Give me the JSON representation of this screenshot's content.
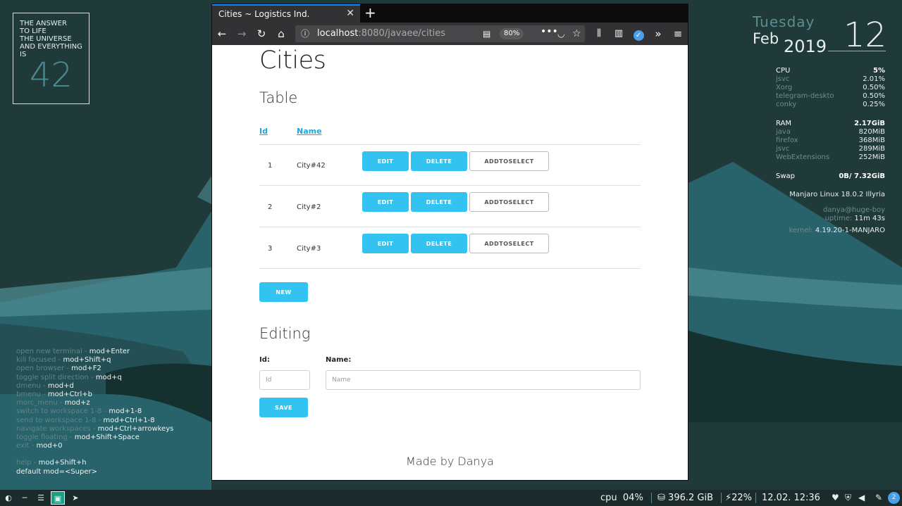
{
  "desktop": {
    "answer_box": {
      "lines": [
        "THE ANSWER",
        "TO LIFE",
        "THE UNIVERSE",
        "AND EVERYTHING",
        "IS"
      ],
      "number": "42"
    },
    "date": {
      "weekday": "Tuesday",
      "month": "Feb",
      "year": "2019",
      "day": "12"
    },
    "conky": {
      "cpu": {
        "label": "CPU",
        "value": "5%",
        "procs": [
          {
            "name": "jsvc",
            "value": "2.01%"
          },
          {
            "name": "Xorg",
            "value": "0.50%"
          },
          {
            "name": "telegram-deskto",
            "value": "0.50%"
          },
          {
            "name": "conky",
            "value": "0.25%"
          }
        ]
      },
      "ram": {
        "label": "RAM",
        "value": "2.17GiB",
        "procs": [
          {
            "name": "java",
            "value": "820MiB"
          },
          {
            "name": "firefox",
            "value": "368MiB"
          },
          {
            "name": "jsvc",
            "value": "289MiB"
          },
          {
            "name": "WebExtensions",
            "value": "252MiB"
          }
        ]
      },
      "swap": {
        "label": "Swap",
        "value": "0B/ 7.32GiB"
      },
      "os": "Manjaro Linux 18.0.2 Illyria",
      "user": "danya@huge-boy",
      "uptime_label": "uptime:",
      "uptime": "11m 43s",
      "kernel_label": "kernel:",
      "kernel": "4.19.20-1-MANJARO"
    },
    "shortcuts": [
      {
        "k": "open new terminal - ",
        "v": "mod+Enter"
      },
      {
        "k": "kill focused - ",
        "v": "mod+Shift+q"
      },
      {
        "k": "open browser - ",
        "v": "mod+F2"
      },
      {
        "k": "toggle split direction - ",
        "v": "mod+q"
      },
      {
        "k": "dmenu - ",
        "v": "mod+d"
      },
      {
        "k": "bmenu - ",
        "v": "mod+Ctrl+b"
      },
      {
        "k": "morc_menu - ",
        "v": "mod+z"
      },
      {
        "k": "switch to workspace 1-8 - ",
        "v": "mod+1-8"
      },
      {
        "k": "send to workspace 1-8 - ",
        "v": "mod+Ctrl+1-8"
      },
      {
        "k": "navigate workspaces - ",
        "v": "mod+Ctrl+arrowkeys"
      },
      {
        "k": "toggle floating - ",
        "v": "mod+Shift+Space"
      },
      {
        "k": "exit - ",
        "v": "mod+0"
      }
    ],
    "shortcuts_help": {
      "k": "help - ",
      "v": "mod+Shift+h"
    },
    "shortcuts_default": "default mod=<Super>"
  },
  "browser": {
    "tab_title": "Cities ~ Logistics Ind.",
    "tab_close": "✕",
    "new_tab": "+",
    "url_host": "localhost",
    "url_path": ":8080/javaee/cities",
    "zoom": "80%",
    "page": {
      "title": "Cities",
      "table_heading": "Table",
      "columns": [
        "Id",
        "Name"
      ],
      "rows": [
        {
          "id": "1",
          "name": "City#42"
        },
        {
          "id": "2",
          "name": "City#2"
        },
        {
          "id": "3",
          "name": "City#3"
        }
      ],
      "edit_label": "EDIT",
      "delete_label": "DELETE",
      "addtoselect_label": "ADDTOSELECT",
      "new_label": "NEW",
      "editing_heading": "Editing",
      "id_label": "Id:",
      "id_placeholder": "Id",
      "name_label": "Name:",
      "name_placeholder": "Name",
      "save_label": "SAVE",
      "footer": "Made by Danya"
    }
  },
  "taskbar": {
    "cpu_label": "cpu",
    "cpu_value": "04%",
    "disk": "396.2 GiB",
    "battery": "22%",
    "datetime": "12.02. 12:36",
    "tray_badge": "2"
  },
  "colors": {
    "accent": "#33c3f0",
    "link": "#1ea7d8",
    "bg": "#1f3a38",
    "firefox_blue": "#0a84ff"
  }
}
